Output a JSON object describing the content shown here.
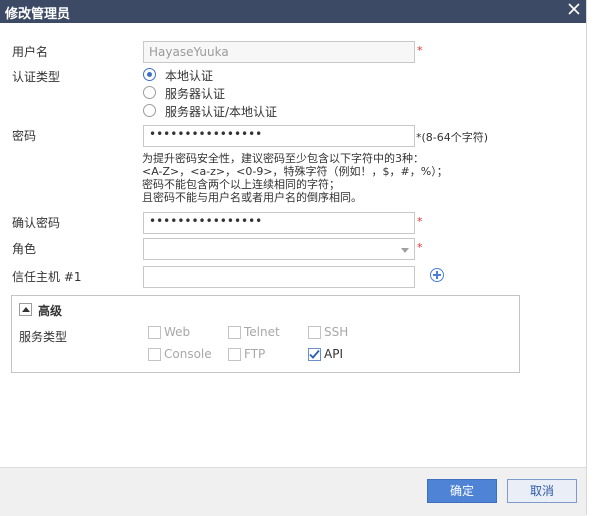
{
  "dialog": {
    "title": "修改管理员"
  },
  "form": {
    "username": {
      "label": "用户名",
      "value": "HayaseYuuka",
      "required": "*"
    },
    "auth_type": {
      "label": "认证类型",
      "options": [
        "本地认证",
        "服务器认证",
        "服务器认证/本地认证"
      ],
      "selected": "本地认证"
    },
    "password": {
      "label": "密码",
      "value": "••••••••••••••••",
      "note": "*(8-64个字符)",
      "hint": [
        "为提升密码安全性，建议密码至少包含以下字符中的3种：",
        "<A-Z>，<a-z>，<0-9>，特殊字符（例如！，$，#，%）；",
        "密码不能包含两个以上连续相同的字符；",
        "且密码不能与用户名或者用户名的倒序相同。"
      ]
    },
    "confirm_password": {
      "label": "确认密码",
      "value": "••••••••••••••••",
      "required": "*"
    },
    "role": {
      "label": "角色",
      "value": "",
      "required": "*"
    },
    "trusted_host": {
      "label": "信任主机 #1",
      "value": ""
    }
  },
  "advanced": {
    "title": "高级",
    "service_type_label": "服务类型",
    "services": [
      {
        "label": "Web",
        "checked": false
      },
      {
        "label": "Telnet",
        "checked": false
      },
      {
        "label": "SSH",
        "checked": false
      },
      {
        "label": "Console",
        "checked": false
      },
      {
        "label": "FTP",
        "checked": false
      },
      {
        "label": "API",
        "checked": true
      }
    ]
  },
  "footer": {
    "ok_label": "确定",
    "cancel_label": "取消"
  },
  "colors": {
    "titlebar": "#3c4a66",
    "accent": "#4f83d6",
    "required": "#e63232"
  },
  "icons": {
    "close": "close-icon",
    "add": "plus-circle-icon",
    "collapse": "collapse-icon",
    "dropdown": "chevron-down-icon"
  }
}
